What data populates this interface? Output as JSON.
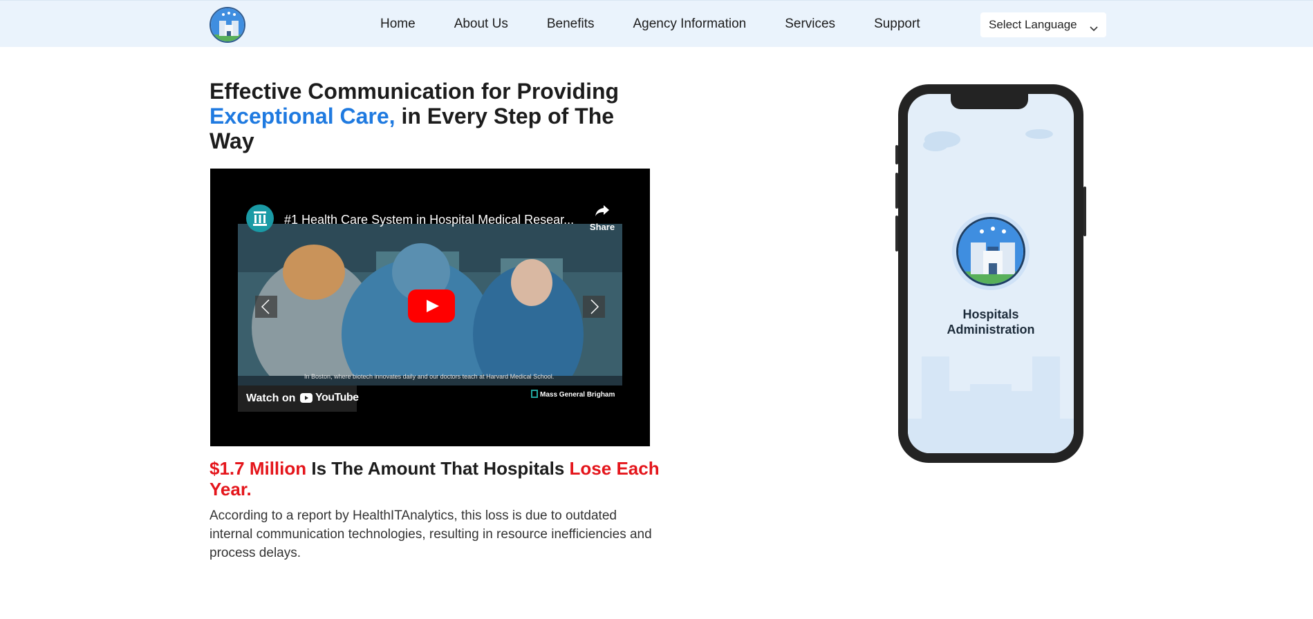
{
  "nav": {
    "logo_icon": "hospital-logo-icon",
    "links": [
      "Home",
      "About Us",
      "Benefits",
      "Agency Information",
      "Services",
      "Support"
    ],
    "language_select": "Select Language"
  },
  "hero": {
    "title_part1": "Effective Communication for Providing ",
    "title_accent": "Exceptional Care,",
    "title_part2": " in Every Step of The Way",
    "accent_color": "#1f7ae0"
  },
  "video": {
    "title": "#1 Health Care System in Hospital Medical Resear...",
    "share_label": "Share",
    "caption": "In Boston, where biotech innovates daily and our doctors teach at Harvard Medical School.",
    "watch_on": "Watch on",
    "youtube": "YouTube",
    "brand": "Mass General Brigham"
  },
  "loss": {
    "amount": "$1.7 Million",
    "middle": " Is The Amount That Hospitals ",
    "end": "Lose Each Year.",
    "description": "According to a report by HealthITAnalytics, this loss is due to outdated internal communication technologies, resulting in resource inefficiencies and process delays.",
    "highlight_color": "#e4151b"
  },
  "phone": {
    "app_line1": "Hospitals",
    "app_line2": "Administration"
  }
}
